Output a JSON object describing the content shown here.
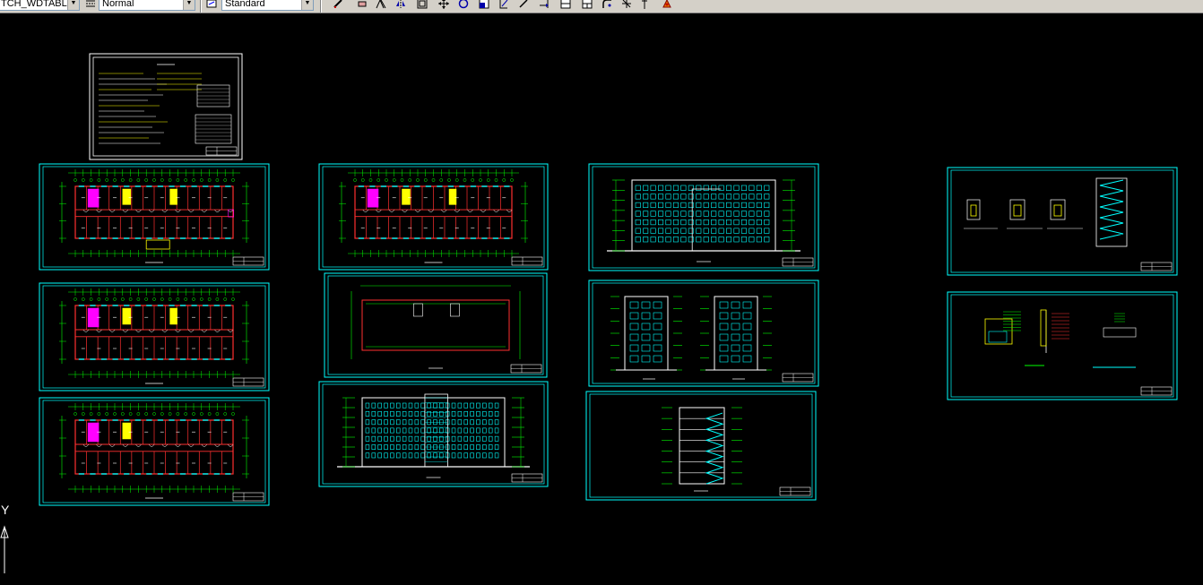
{
  "toolbar": {
    "textstyle_combo": "TCH_WDTABLE",
    "linetype_combo": "Normal",
    "dimstyle_combo": "Standard",
    "icons": [
      "text-style-icon",
      "line-type-icon",
      "dim-style-icon",
      "pencil-icon",
      "eraser-icon",
      "copy-icon",
      "mirror-icon",
      "offset-icon",
      "move-icon",
      "rotate-icon",
      "scale-icon",
      "stretch-icon",
      "trim-icon",
      "extend-icon",
      "break-icon",
      "chamfer-icon",
      "fillet-icon",
      "explode-icon",
      "properties-icon"
    ]
  },
  "canvas": {
    "background": "#000000",
    "frame_color": "#00ffff",
    "ucs_axis_label": "Y",
    "sheets": [
      {
        "name": "design-notes-sheet",
        "kind": "notes"
      },
      {
        "name": "floor-plan-ground-sheet",
        "kind": "plan"
      },
      {
        "name": "floor-plan-standard-sheet",
        "kind": "plan"
      },
      {
        "name": "floor-plan-top-sheet",
        "kind": "plan"
      },
      {
        "name": "floor-plan-upper-sheet",
        "kind": "plan"
      },
      {
        "name": "roof-plan-sheet",
        "kind": "roof"
      },
      {
        "name": "front-elevation-sheet",
        "kind": "elevation"
      },
      {
        "name": "rear-elevation-sheet",
        "kind": "elevation"
      },
      {
        "name": "side-elevations-sheet",
        "kind": "side-elevation"
      },
      {
        "name": "section-sheet",
        "kind": "section"
      },
      {
        "name": "details-sheet-1",
        "kind": "details"
      },
      {
        "name": "details-sheet-2",
        "kind": "details"
      }
    ]
  }
}
